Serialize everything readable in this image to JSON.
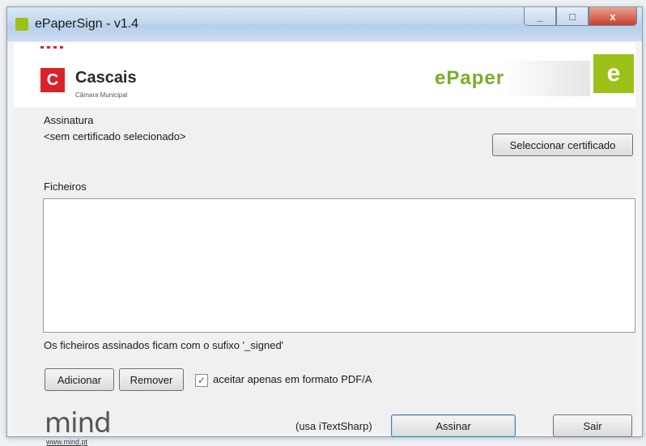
{
  "window": {
    "title": "ePaperSign - v1.4",
    "controls": [
      "minimize",
      "maximize",
      "close"
    ],
    "close_symbol": "x",
    "maximize_symbol": "□",
    "minimize_symbol": "_"
  },
  "header": {
    "org_initial": "C",
    "org_name": "Cascais",
    "org_subtitle": "Câmara Municipal",
    "product_word": "ePaper",
    "product_badge": "e"
  },
  "signature": {
    "label": "Assinatura",
    "value": "<sem certificado selecionado>",
    "select_button": "Seleccionar certificado"
  },
  "files": {
    "label": "Ficheiros",
    "items": [],
    "note": "Os ficheiros assinados ficam com o sufixo '_signed'"
  },
  "actions": {
    "add": "Adicionar",
    "remove": "Remover",
    "pdfa_checkbox_label": "aceitar apenas em formato PDF/A",
    "pdfa_checked": true,
    "credit": "(usa iTextSharp)",
    "sign": "Assinar",
    "exit": "Sair"
  },
  "footer": {
    "brand": "mind",
    "url": "www.mind.pt"
  },
  "colors": {
    "brand_red": "#d8232a",
    "brand_green": "#9cc21a",
    "title_bar": "#c3d8ee"
  }
}
